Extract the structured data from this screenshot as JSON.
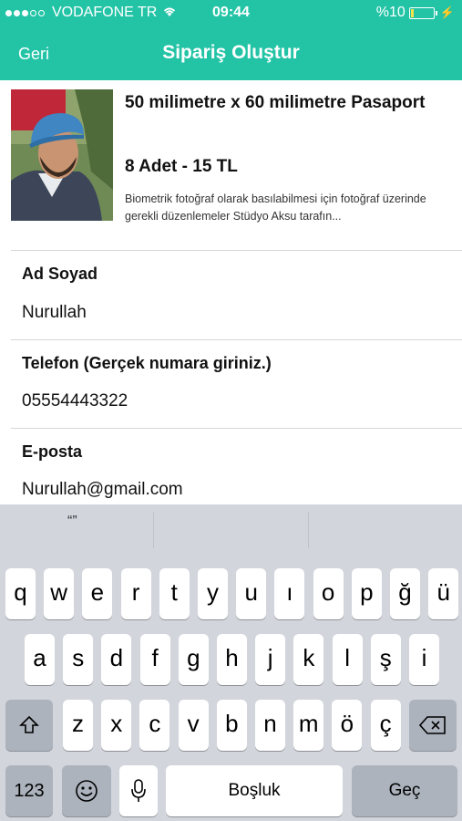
{
  "status_bar": {
    "carrier": "VODAFONE TR",
    "time": "09:44",
    "battery_text": "%10"
  },
  "nav": {
    "back_label": "Geri",
    "title": "Sipariş Oluştur"
  },
  "product": {
    "title": "50 milimetre x 60 milimetre Pasaport",
    "price": "8 Adet - 15 TL",
    "description": "Biometrik fotoğraf olarak basılabilmesi için fotoğraf üzerinde gerekli düzenlemeler Stüdyo Aksu tarafın..."
  },
  "form": {
    "name_label": "Ad Soyad",
    "name_value": "Nurullah",
    "phone_label": "Telefon (Gerçek numara giriniz.)",
    "phone_value": "05554443322",
    "email_label": "E-posta",
    "email_value": "Nurullah@gmail.com"
  },
  "keyboard": {
    "prediction_left": "“”",
    "row1": [
      "q",
      "w",
      "e",
      "r",
      "t",
      "y",
      "u",
      "ı",
      "o",
      "p",
      "ğ",
      "ü"
    ],
    "row2": [
      "a",
      "s",
      "d",
      "f",
      "g",
      "h",
      "j",
      "k",
      "l",
      "ş",
      "i"
    ],
    "row3": [
      "z",
      "x",
      "c",
      "v",
      "b",
      "n",
      "m",
      "ö",
      "ç"
    ],
    "numbers_label": "123",
    "space_label": "Boşluk",
    "return_label": "Geç",
    "shift_icon": "shift-icon",
    "delete_icon": "delete-icon",
    "emoji_icon": "emoji-icon",
    "mic_icon": "microphone-icon"
  },
  "colors": {
    "accent": "#23c4a6",
    "keyboard_bg": "#d2d5db",
    "key_dark": "#acb3bd"
  }
}
